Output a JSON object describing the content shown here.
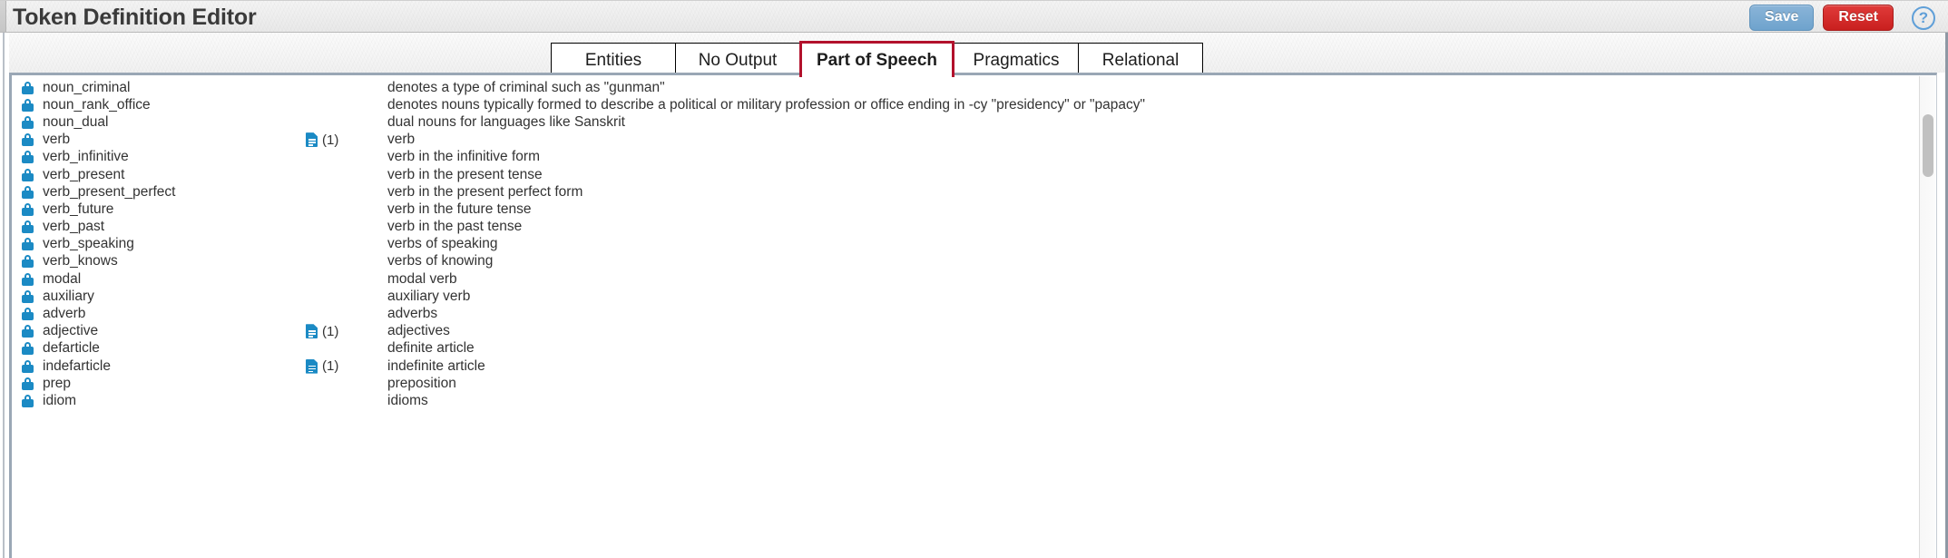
{
  "header": {
    "title": "Token Definition Editor",
    "save_label": "Save",
    "reset_label": "Reset",
    "help_glyph": "?",
    "save_color": "#6fa3cd",
    "reset_color": "#c9201f"
  },
  "tabs": [
    {
      "label": "Entities",
      "active": false
    },
    {
      "label": "No Output",
      "active": false
    },
    {
      "label": "Part of Speech",
      "active": true
    },
    {
      "label": "Pragmatics",
      "active": false
    },
    {
      "label": "Relational",
      "active": false
    }
  ],
  "tab_active_border_color": "#b2112c",
  "list": {
    "lock_icon": "lock-icon",
    "doc_icon": "document-icon",
    "lock_color": "#1b8ac4",
    "rows": [
      {
        "locked": true,
        "name": "noun_criminal",
        "doc_count": "",
        "description": "denotes a type of criminal such as \"gunman\""
      },
      {
        "locked": true,
        "name": "noun_rank_office",
        "doc_count": "",
        "description": "denotes nouns typically formed to describe a political or military profession or office ending in -cy \"presidency\" or \"papacy\""
      },
      {
        "locked": true,
        "name": "noun_dual",
        "doc_count": "",
        "description": "dual nouns for languages like Sanskrit"
      },
      {
        "locked": true,
        "name": "verb",
        "doc_count": "(1)",
        "description": "verb"
      },
      {
        "locked": true,
        "name": "verb_infinitive",
        "doc_count": "",
        "description": "verb in the infinitive form"
      },
      {
        "locked": true,
        "name": "verb_present",
        "doc_count": "",
        "description": "verb in the present tense"
      },
      {
        "locked": true,
        "name": "verb_present_perfect",
        "doc_count": "",
        "description": "verb in the present perfect form"
      },
      {
        "locked": true,
        "name": "verb_future",
        "doc_count": "",
        "description": "verb in the future tense"
      },
      {
        "locked": true,
        "name": "verb_past",
        "doc_count": "",
        "description": "verb in the past tense"
      },
      {
        "locked": true,
        "name": "verb_speaking",
        "doc_count": "",
        "description": "verbs of speaking"
      },
      {
        "locked": true,
        "name": "verb_knows",
        "doc_count": "",
        "description": "verbs of knowing"
      },
      {
        "locked": true,
        "name": "modal",
        "doc_count": "",
        "description": "modal verb"
      },
      {
        "locked": true,
        "name": "auxiliary",
        "doc_count": "",
        "description": "auxiliary verb"
      },
      {
        "locked": true,
        "name": "adverb",
        "doc_count": "",
        "description": "adverbs"
      },
      {
        "locked": true,
        "name": "adjective",
        "doc_count": "(1)",
        "description": "adjectives"
      },
      {
        "locked": true,
        "name": "defarticle",
        "doc_count": "",
        "description": "definite article"
      },
      {
        "locked": true,
        "name": "indefarticle",
        "doc_count": "(1)",
        "description": "indefinite article"
      },
      {
        "locked": true,
        "name": "prep",
        "doc_count": "",
        "description": "preposition"
      },
      {
        "locked": true,
        "name": "idiom",
        "doc_count": "",
        "description": "idioms"
      }
    ]
  },
  "scrollbar": {
    "thumb_position_pct": 8,
    "thumb_size_pct": 13
  }
}
